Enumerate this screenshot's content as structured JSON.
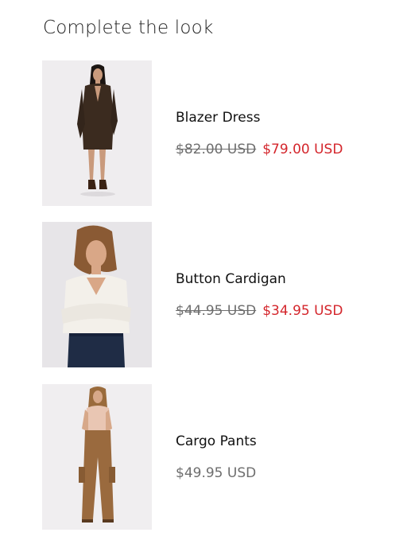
{
  "section": {
    "heading": "Complete the look"
  },
  "products": [
    {
      "title": "Blazer Dress",
      "compare_price": "$82.00 USD",
      "price": "$79.00 USD",
      "on_sale": true,
      "image_icon": "model-photo-blazer-dress"
    },
    {
      "title": "Button Cardigan",
      "compare_price": "$44.95 USD",
      "price": "$34.95 USD",
      "on_sale": true,
      "image_icon": "model-photo-button-cardigan"
    },
    {
      "title": "Cargo Pants",
      "price": "$49.95 USD",
      "on_sale": false,
      "image_icon": "model-photo-cargo-pants"
    }
  ],
  "colors": {
    "sale": "#d4262c",
    "muted": "#6e6e6e",
    "text": "#111111"
  }
}
